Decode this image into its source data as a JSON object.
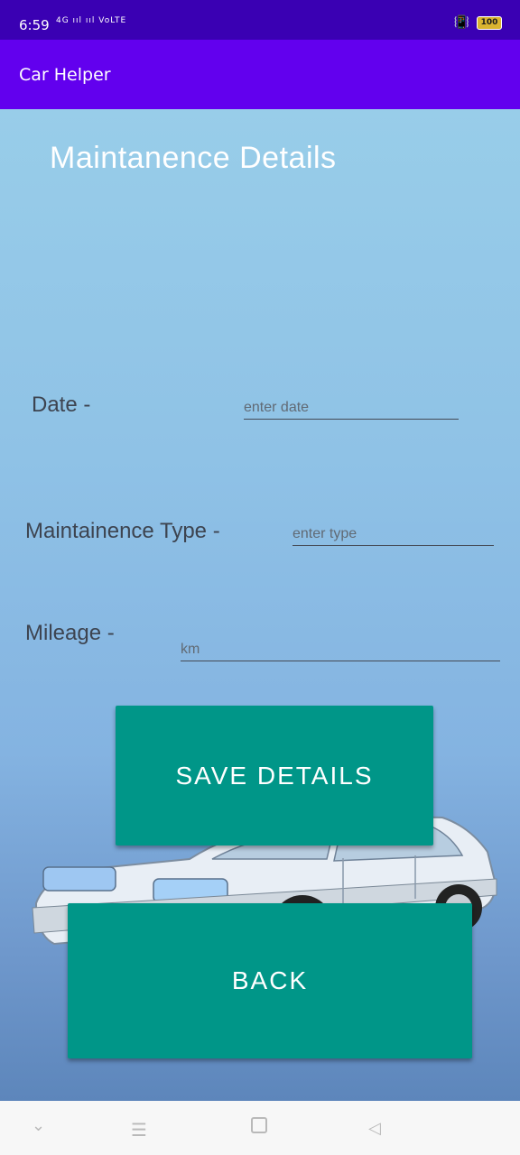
{
  "status_bar": {
    "time": "6:59",
    "signal": "4G ııl ııl VoLTE",
    "battery": "100"
  },
  "app_bar": {
    "title": "Car Helper"
  },
  "page": {
    "title": "Maintanence Details"
  },
  "form": {
    "date_label": "Date -",
    "date_placeholder": "enter date",
    "type_label": "Maintainence Type -",
    "type_placeholder": "enter type",
    "mileage_label": "Mileage -",
    "mileage_placeholder": "km"
  },
  "buttons": {
    "save": "SAVE DETAILS",
    "back": "BACK"
  },
  "colors": {
    "status_bar": "#3a00b3",
    "app_bar": "#6200ee",
    "button": "#009688"
  },
  "icons": {
    "vibrate": "vibrate-icon",
    "battery": "battery-icon",
    "nav_collapse": "chevron-down-icon",
    "nav_menu": "menu-icon",
    "nav_home": "home-icon",
    "nav_back": "back-triangle-icon"
  }
}
